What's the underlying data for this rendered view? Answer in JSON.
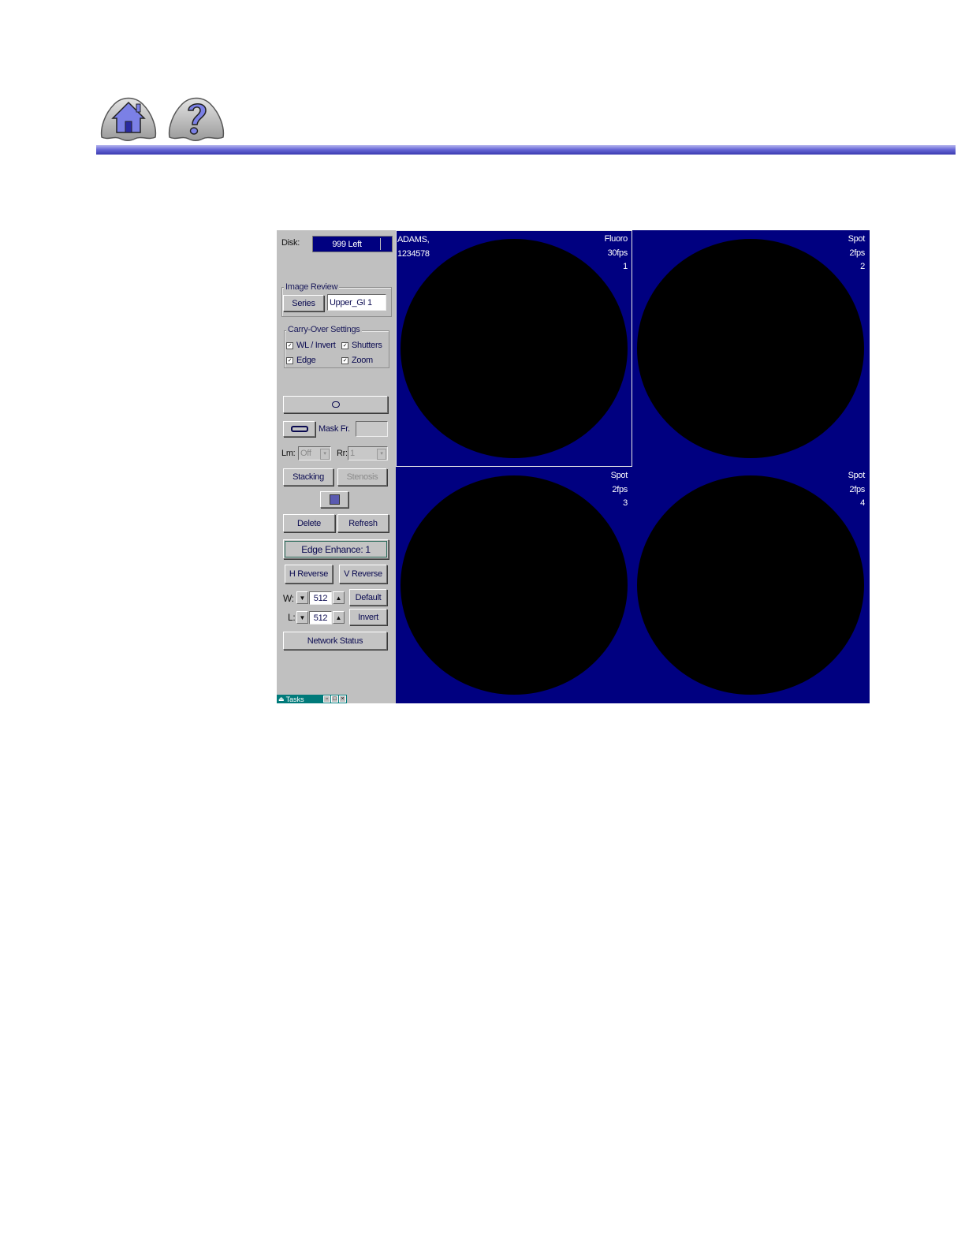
{
  "header": {
    "home_icon": "home-icon",
    "help_icon": "help-question-icon",
    "rule_color": "#4a4ac0"
  },
  "panel": {
    "disk_label": "Disk:",
    "disk_value": "999 Left",
    "image_review": {
      "title": "Image Review",
      "series_button": "Series",
      "series_value": "Upper_GI 1"
    },
    "carry_over": {
      "title": "Carry-Over Settings",
      "items": [
        {
          "label": "WL / Invert",
          "checked": true
        },
        {
          "label": "Shutters",
          "checked": true
        },
        {
          "label": "Edge",
          "checked": true
        },
        {
          "label": "Zoom",
          "checked": true
        }
      ]
    },
    "link_icon": "link-icon",
    "mask_icon": "mask-icon",
    "mask_label": "Mask Fr.",
    "mask_value": "",
    "lm_label": "Lm:",
    "lm_value": "Off",
    "rr_label": "Rr:",
    "rr_value": "1",
    "stacking_button": "Stacking",
    "stenosis_button": "Stenosis",
    "color_swatch_icon": "color-swatch-icon",
    "delete_button": "Delete",
    "refresh_button": "Refresh",
    "edge_enhance_button": "Edge Enhance:  1",
    "h_reverse_button": "H Reverse",
    "v_reverse_button": "V Reverse",
    "w_label": "W:",
    "w_value": "512",
    "default_button": "Default",
    "l_label": "L:",
    "l_value": "512",
    "invert_button": "Invert",
    "network_status_button": "Network Status",
    "taskbar_label": "Tasks"
  },
  "viewports": [
    {
      "patient_name": "ADAMS,",
      "patient_id": "1234578",
      "mode": "Fluoro",
      "rate": "30fps",
      "index": "1",
      "selected": true
    },
    {
      "patient_name": "",
      "patient_id": "",
      "mode": "Spot",
      "rate": "2fps",
      "index": "2",
      "selected": false
    },
    {
      "patient_name": "",
      "patient_id": "",
      "mode": "Spot",
      "rate": "2fps",
      "index": "3",
      "selected": false
    },
    {
      "patient_name": "",
      "patient_id": "",
      "mode": "Spot",
      "rate": "2fps",
      "index": "4",
      "selected": false
    }
  ]
}
